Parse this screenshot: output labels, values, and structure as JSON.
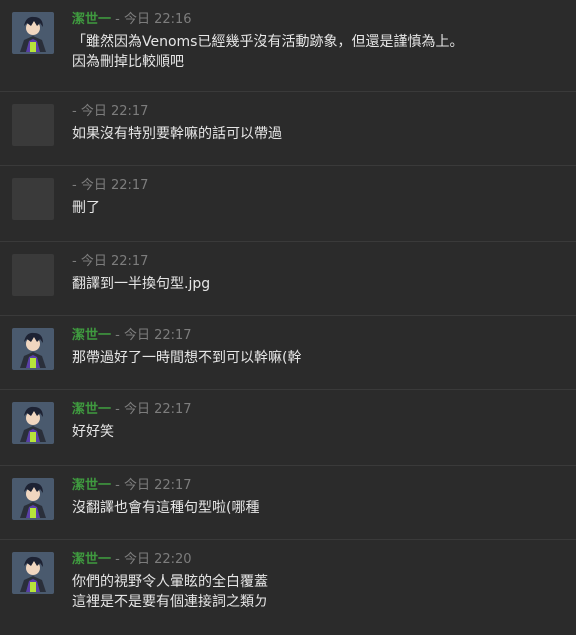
{
  "messages": [
    {
      "author": "潔世一",
      "separator": " - ",
      "time": "今日 22:16",
      "text": "「雖然因為Venoms已經幾乎沒有活動跡象，但還是謹慎為上。\n因為刪掉比較順吧",
      "has_avatar": true
    },
    {
      "author": "",
      "separator": " - ",
      "time": "今日 22:17",
      "text": "如果沒有特別要幹嘛的話可以帶過",
      "has_avatar": false
    },
    {
      "author": "",
      "separator": " - ",
      "time": "今日 22:17",
      "text": "刪了",
      "has_avatar": false
    },
    {
      "author": "",
      "separator": " - ",
      "time": "今日 22:17",
      "text": "翻譯到一半換句型.jpg",
      "has_avatar": false
    },
    {
      "author": "潔世一",
      "separator": " - ",
      "time": "今日 22:17",
      "text": "那帶過好了一時間想不到可以幹嘛(幹",
      "has_avatar": true
    },
    {
      "author": "潔世一",
      "separator": " - ",
      "time": "今日 22:17",
      "text": "好好笑",
      "has_avatar": true
    },
    {
      "author": "潔世一",
      "separator": " - ",
      "time": "今日 22:17",
      "text": "沒翻譯也會有這種句型啦(哪種",
      "has_avatar": true
    },
    {
      "author": "潔世一",
      "separator": " - ",
      "time": "今日 22:20",
      "text": "你們的視野令人暈眩的全白覆蓋\n這裡是不是要有個連接詞之類ㄉ",
      "has_avatar": true
    }
  ],
  "colors": {
    "background": "#2b2b2b",
    "author": "#3f9a3f",
    "timestamp": "#7d7d7d",
    "text": "#e6e6e6",
    "divider": "#3a3a3a"
  }
}
